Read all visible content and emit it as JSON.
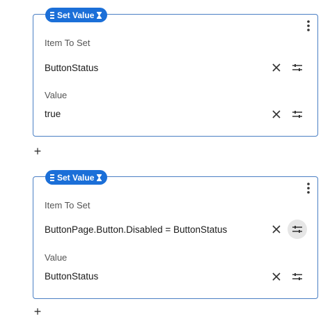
{
  "blocks": [
    {
      "title": "Set Value",
      "item_label": "Item To Set",
      "item_value": "ButtonStatus",
      "value_label": "Value",
      "value_value": "true"
    },
    {
      "title": "Set Value",
      "item_label": "Item To Set",
      "item_value": "ButtonPage.Button.Disabled = ButtonStatus",
      "value_label": "Value",
      "value_value": "ButtonStatus"
    }
  ],
  "add_symbol": "+",
  "colors": {
    "accent": "#1b6fd8",
    "border": "#4a7fc4",
    "hover": "#e6e6e6"
  },
  "icons": [
    "drag-handle-icon",
    "hourglass-icon",
    "more-vertical-icon",
    "close-icon",
    "tune-icon",
    "plus-icon"
  ]
}
